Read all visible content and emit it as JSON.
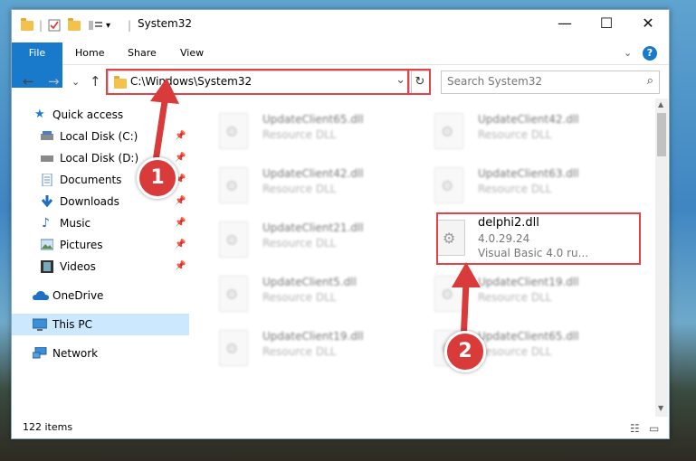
{
  "window": {
    "title": "System32",
    "minimize": "—",
    "maximize": "☐",
    "close": "✕"
  },
  "ribbon": {
    "tabs": [
      {
        "label": "File"
      },
      {
        "label": "Home"
      },
      {
        "label": "Share"
      },
      {
        "label": "View"
      }
    ],
    "expand": "⌄",
    "help": "?"
  },
  "nav": {
    "back": "←",
    "forward": "→",
    "recent": "⌄",
    "up": "↑",
    "address": "C:\\Windows\\System32",
    "address_dropdown": "⌄",
    "refresh": "↻",
    "search_placeholder": "Search System32",
    "search_icon": "⌕"
  },
  "sidebar": {
    "items": [
      {
        "label": "Quick access",
        "icon": "star-icon"
      },
      {
        "label": "Local Disk (C:)",
        "icon": "drive-icon"
      },
      {
        "label": "Local Disk (D:)",
        "icon": "drive-icon"
      },
      {
        "label": "Documents",
        "icon": "documents-icon"
      },
      {
        "label": "Downloads",
        "icon": "downloads-icon"
      },
      {
        "label": "Music",
        "icon": "music-icon"
      },
      {
        "label": "Pictures",
        "icon": "pictures-icon"
      },
      {
        "label": "Videos",
        "icon": "videos-icon"
      },
      {
        "label": "OneDrive",
        "icon": "cloud-icon"
      },
      {
        "label": "This PC",
        "icon": "computer-icon"
      },
      {
        "label": "Network",
        "icon": "network-icon"
      }
    ],
    "pin_glyph": "📌"
  },
  "files": [
    {
      "name": "UpdateClient65.dll",
      "desc": "Resource DLL"
    },
    {
      "name": "UpdateClient42.dll",
      "desc": "Resource DLL"
    },
    {
      "name": "UpdateClient42.dll",
      "desc": "Resource DLL"
    },
    {
      "name": "UpdateClient63.dll",
      "desc": "Resource DLL"
    },
    {
      "name": "UpdateClient21.dll",
      "desc": "Resource DLL"
    },
    {
      "name": "delphi2.dll",
      "version": "4.0.29.24",
      "desc": "Visual Basic 4.0 ru..."
    },
    {
      "name": "UpdateClient5.dll",
      "desc": "Resource DLL"
    },
    {
      "name": "UpdateClient19.dll",
      "desc": "Resource DLL"
    },
    {
      "name": "UpdateClient19.dll",
      "desc": "Resource DLL"
    },
    {
      "name": "UpdateClient65.dll",
      "desc": "Resource DLL"
    }
  ],
  "status": {
    "count": "122 items",
    "details_view": "☷",
    "tiles_view": "▭"
  },
  "annotations": {
    "step1": "1",
    "step2": "2",
    "highlight_color": "#e0434a"
  },
  "colors": {
    "accent": "#1979ca",
    "selected": "#cce8ff"
  }
}
